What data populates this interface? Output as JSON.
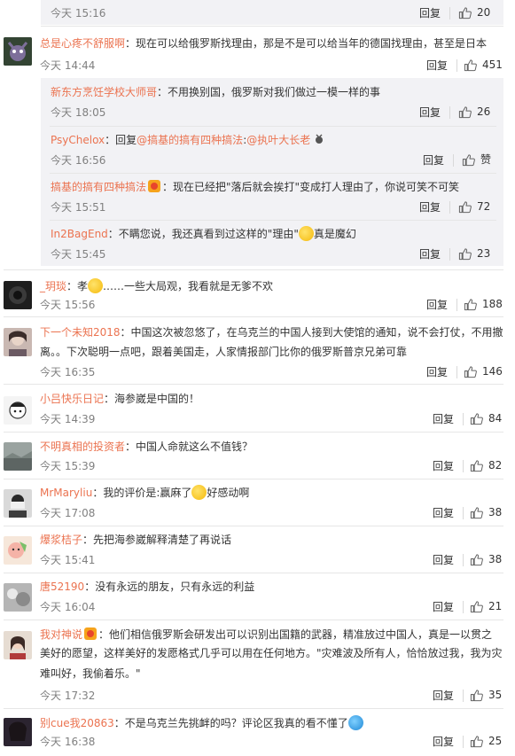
{
  "reply_label": "回复",
  "top_item": {
    "time": "今天 15:16",
    "likes": "20"
  },
  "comments": [
    {
      "user": "总是心疼不舒服啊",
      "text": "：现在可以给俄罗斯找理由，那是不是可以给当年的德国找理由，甚至是日本",
      "time": "今天 14:44",
      "likes": "451",
      "replies": [
        {
          "user": "新东方烹饪学校大师哥",
          "text": "：不用换别国，俄罗斯对我们做过一模一样的事",
          "time": "今天 18:05",
          "likes": "26"
        },
        {
          "user": "PsyChelox",
          "pre": "：回复",
          "mention": "@搞基的搞有四种搞法",
          "post": ":",
          "mention2": "@执叶大长老",
          "time": "今天 16:56",
          "likes": "赞"
        },
        {
          "user": "搞基的搞有四种搞法",
          "text": "：现在已经把\"落后就会挨打\"变成打人理由了，你说可笑不可笑",
          "time": "今天 15:51",
          "likes": "72"
        },
        {
          "user": "In2BagEnd",
          "text": "：不瞒您说，我还真看到过这样的\"理由\"",
          "text_after": "真是魔幻",
          "time": "今天 15:45",
          "likes": "23"
        }
      ]
    },
    {
      "user": "_玥琰",
      "text": "：孝",
      "text_after": "……一些大局观，我看就是无爹不欢",
      "time": "今天 15:56",
      "likes": "188"
    },
    {
      "user": "下一个未知2018",
      "text": "：中国这次被忽悠了，在乌克兰的中国人接到大使馆的通知，说不会打仗，不用撤",
      "text2": "离。。下次聪明一点吧，跟着美国走，人家情报部门比你的俄罗斯普京兄弟可靠",
      "time": "今天 16:35",
      "likes": "146"
    },
    {
      "user": "小吕快乐日记",
      "text": "：海参崴是中国的！",
      "time": "今天 14:39",
      "likes": "84"
    },
    {
      "user": "不明真相的投资者",
      "text": "：中国人命就这么不值钱？",
      "time": "今天 15:39",
      "likes": "82"
    },
    {
      "user": "MrMaryliu",
      "text": "：我的评价是:赢麻了",
      "text_after": "好感动啊",
      "time": "今天 17:08",
      "likes": "38"
    },
    {
      "user": "爆浆桔子",
      "text": "：先把海参崴解释清楚了再说话",
      "time": "今天 15:41",
      "likes": "38"
    },
    {
      "user": "唐52190",
      "text": "：没有永远的朋友，只有永远的利益",
      "time": "今天 16:04",
      "likes": "21"
    },
    {
      "user": "我对神说",
      "text": "：他们相信俄罗斯会研发出可以识别出国籍的武器，精准放过中国人，真是一以贯之",
      "text2": "美好的愿望，这样美好的发愿格式几乎可以用在任何地方。\"灾难波及所有人，恰恰放过我，我为灾",
      "text3": "难叫好，我偷着乐。\"",
      "time": "今天 17:32",
      "likes": "35"
    },
    {
      "user": "别cue我20863",
      "text": "：不是乌克兰先挑衅的吗？评论区我真的看不懂了",
      "time": "今天 16:38",
      "likes": "25"
    }
  ]
}
